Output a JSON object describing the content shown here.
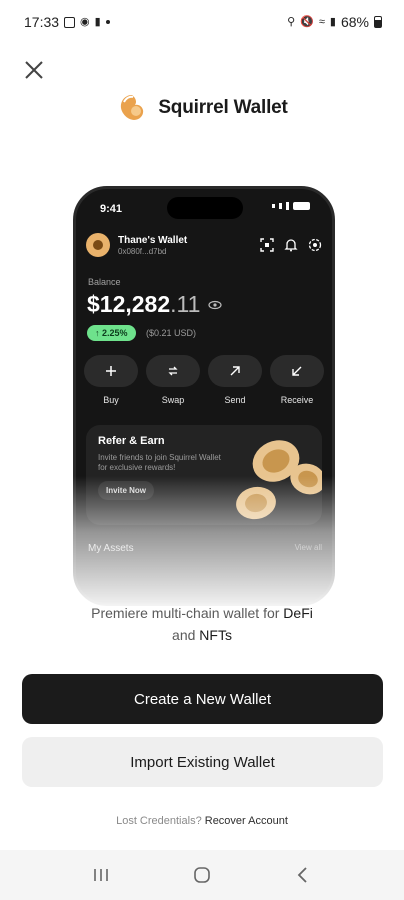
{
  "status_bar": {
    "time": "17:33",
    "battery_pct": "68%"
  },
  "app": {
    "name": "Squirrel Wallet"
  },
  "phone_mockup": {
    "time": "9:41",
    "wallet_name": "Thane's Wallet",
    "wallet_address": "0x080f...d7bd",
    "balance_label": "Balance",
    "balance_main": "$12,282",
    "balance_cents": ".11",
    "change_badge": "↑ 2.25%",
    "change_amount": "($0.21 USD)",
    "actions": [
      {
        "label": "Buy",
        "icon": "plus-icon"
      },
      {
        "label": "Swap",
        "icon": "swap-icon"
      },
      {
        "label": "Send",
        "icon": "send-arrow-icon"
      },
      {
        "label": "Receive",
        "icon": "receive-arrow-icon"
      }
    ],
    "refer": {
      "title": "Refer & Earn",
      "description": "Invite friends to join Squirrel Wallet for exclusive rewards!",
      "button": "Invite Now"
    },
    "assets_label": "My Assets",
    "view_all": "View all"
  },
  "tagline": {
    "line1": "Premiere multi-chain wallet for ",
    "defi": "DeFi",
    "line2_pre": "and ",
    "nfts": "NFTs"
  },
  "buttons": {
    "create": "Create a New Wallet",
    "import": "Import Existing Wallet"
  },
  "recover": {
    "prompt": "Lost Credentials?",
    "link": "Recover Account"
  },
  "colors": {
    "accent": "#e9a04a",
    "primary_button": "#1b1b1b",
    "secondary_button": "#efefef",
    "gain": "#6ee28c"
  }
}
